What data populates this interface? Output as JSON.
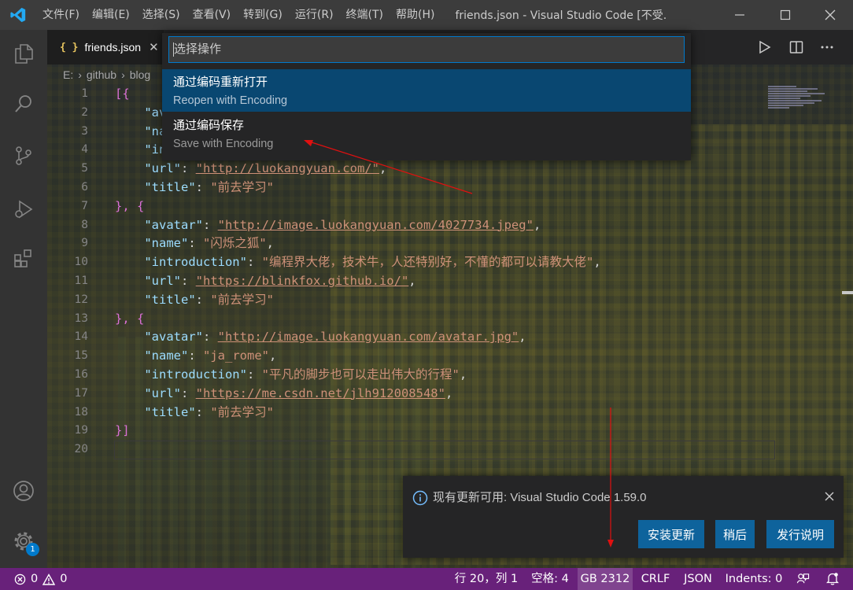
{
  "titlebar": {
    "logo_icon": "vscode-logo-icon",
    "menu": [
      "文件(F)",
      "编辑(E)",
      "选择(S)",
      "查看(V)",
      "转到(G)",
      "运行(R)",
      "终端(T)",
      "帮助(H)"
    ],
    "window_title": "friends.json - Visual Studio Code [不受..."
  },
  "activity_bar": {
    "icons": [
      "explorer-icon",
      "search-icon",
      "source-control-icon",
      "run-debug-icon",
      "extensions-icon",
      "accounts-icon",
      "settings-gear-icon"
    ],
    "settings_badge": "1"
  },
  "tab": {
    "icon": "{ }",
    "label": "friends.json"
  },
  "breadcrumbs": [
    "E:",
    "github",
    "blog"
  ],
  "quick_pick": {
    "placeholder": "选择操作",
    "items": [
      {
        "label": "通过编码重新打开",
        "description": "Reopen with Encoding"
      },
      {
        "label": "通过编码保存",
        "description": "Save with Encoding"
      }
    ]
  },
  "code": {
    "line_numbers": [
      "1",
      "2",
      "3",
      "4",
      "5",
      "6",
      "7",
      "8",
      "9",
      "10",
      "11",
      "12",
      "13",
      "14",
      "15",
      "16",
      "17",
      "18",
      "19",
      "20"
    ],
    "visible": {
      "l1": "[{",
      "l2": "\"av",
      "l3": "\"na",
      "l4": "\"in",
      "l5_key": "\"url\"",
      "l5_val": "\"http://luokangyuan.com/\"",
      "l6_key": "\"title\"",
      "l6_val": "\"前去学习\"",
      "l7": "}, {",
      "l8_key": "\"avatar\"",
      "l8_val": "\"http://image.luokangyuan.com/4027734.jpeg\"",
      "l9_key": "\"name\"",
      "l9_val": "\"闪烁之狐\"",
      "l10_key": "\"introduction\"",
      "l10_val": "\"编程界大佬，技术牛，人还特别好，不懂的都可以请教大佬\"",
      "l11_key": "\"url\"",
      "l11_val": "\"https://blinkfox.github.io/\"",
      "l12_key": "\"title\"",
      "l12_val": "\"前去学习\"",
      "l13": "}, {",
      "l14_key": "\"avatar\"",
      "l14_val": "\"http://image.luokangyuan.com/avatar.jpg\"",
      "l15_key": "\"name\"",
      "l15_val": "\"ja_rome\"",
      "l16_key": "\"introduction\"",
      "l16_val": "\"平凡的脚步也可以走出伟大的行程\"",
      "l17_key": "\"url\"",
      "l17_val": "\"https://me.csdn.net/jlh912008548\"",
      "l18_key": "\"title\"",
      "l18_val": "\"前去学习\"",
      "l19": "}]"
    }
  },
  "notification": {
    "message": "现有更新可用: Visual Studio Code 1.59.0",
    "buttons": [
      "安装更新",
      "稍后",
      "发行说明"
    ]
  },
  "statusbar": {
    "errors": "0",
    "warnings": "0",
    "position": "行 20，列 1",
    "spaces": "空格: 4",
    "encoding": "GB 2312",
    "eol": "CRLF",
    "language": "JSON",
    "indents": "Indents: 0"
  },
  "colors": {
    "statusbar_bg": "#68217a",
    "accent": "#007acc",
    "button_bg": "#0e639c",
    "annotation_red": "#e01010"
  }
}
